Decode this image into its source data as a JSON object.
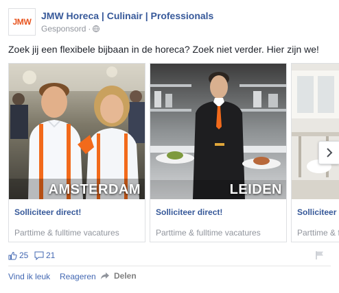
{
  "post": {
    "logo_text": "JMW",
    "page_name": "JMW Horeca | Culinair | Professionals",
    "sponsored_label": "Gesponsord",
    "meta_separator": "·",
    "text": "Zoek jij een flexibele bijbaan in de horeca? Zoek niet verder. Hier zijn we!"
  },
  "carousel": {
    "cards": [
      {
        "caption": "AMSTERDAM",
        "title": "Solliciteer direct!",
        "description": "Parttime & fulltime vacatures"
      },
      {
        "caption": "LEIDEN",
        "title": "Solliciteer direct!",
        "description": "Parttime & fulltime vacatures"
      },
      {
        "caption": "",
        "title": "Solliciteer direct!",
        "description": "Parttime & fulltime vacatures"
      }
    ]
  },
  "stats": {
    "likes": "25",
    "comments": "21"
  },
  "actions": {
    "like": "Vind ik leuk",
    "comment": "Reageren",
    "share": "Delen"
  },
  "colors": {
    "link_blue": "#365899",
    "brand_orange": "#e8541e",
    "muted": "#90949c"
  }
}
